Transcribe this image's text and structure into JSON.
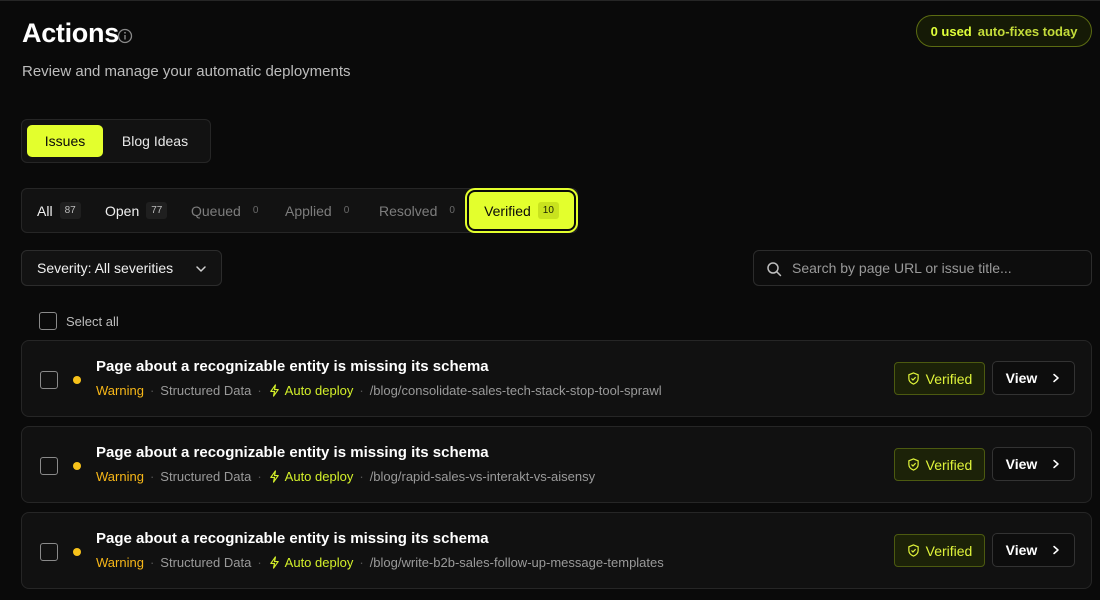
{
  "header": {
    "title": "Actions",
    "subtitle": "Review and manage your automatic deployments",
    "usage_used": "0 used",
    "usage_rest": "auto-fixes today"
  },
  "type_tabs": [
    {
      "label": "Issues",
      "active": true
    },
    {
      "label": "Blog Ideas",
      "active": false
    }
  ],
  "status_tabs": [
    {
      "label": "All",
      "count": "87"
    },
    {
      "label": "Open",
      "count": "77"
    },
    {
      "label": "Queued",
      "count": "0"
    },
    {
      "label": "Applied",
      "count": "0"
    },
    {
      "label": "Resolved",
      "count": "0"
    },
    {
      "label": "Verified",
      "count": "10",
      "active": true
    }
  ],
  "filters": {
    "severity_label": "Severity: All severities",
    "search_placeholder": "Search by page URL or issue title..."
  },
  "select_all_label": "Select all",
  "issues": [
    {
      "title": "Page about a recognizable entity is missing its schema",
      "severity": "Warning",
      "category": "Structured Data",
      "deploy": "Auto deploy",
      "path": "/blog/consolidate-sales-tech-stack-stop-tool-sprawl",
      "status": "Verified",
      "action": "View"
    },
    {
      "title": "Page about a recognizable entity is missing its schema",
      "severity": "Warning",
      "category": "Structured Data",
      "deploy": "Auto deploy",
      "path": "/blog/rapid-sales-vs-interakt-vs-aisensy",
      "status": "Verified",
      "action": "View"
    },
    {
      "title": "Page about a recognizable entity is missing its schema",
      "severity": "Warning",
      "category": "Structured Data",
      "deploy": "Auto deploy",
      "path": "/blog/write-b2b-sales-follow-up-message-templates",
      "status": "Verified",
      "action": "View"
    }
  ],
  "colors": {
    "accent": "#e3ff2d",
    "warning": "#f7b718",
    "background": "#0a0a0a"
  },
  "icons": [
    "info-icon",
    "chevron-down-icon",
    "search-icon",
    "bolt-icon",
    "shield-check-icon",
    "chevron-right-icon"
  ]
}
